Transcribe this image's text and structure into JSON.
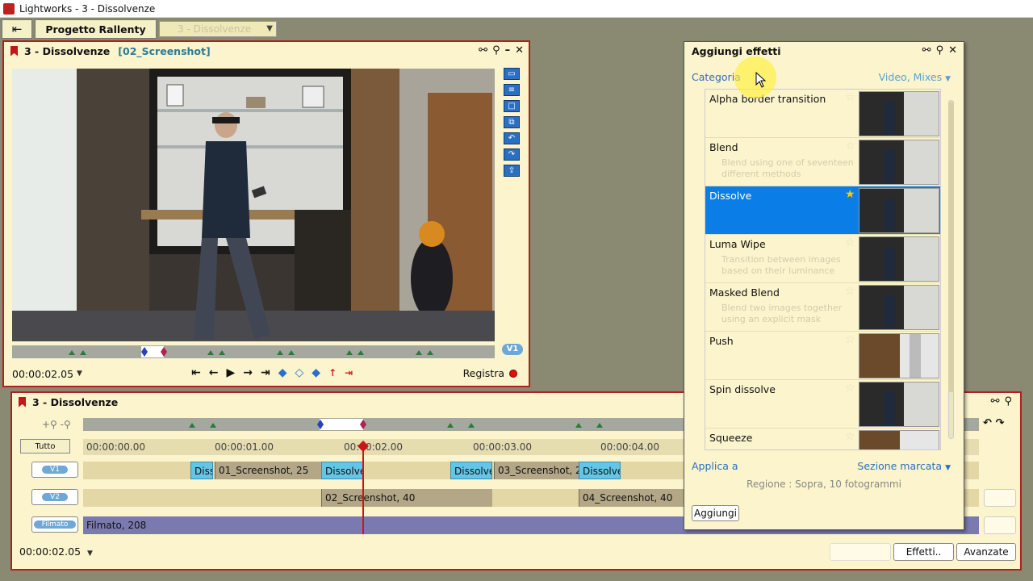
{
  "window": {
    "title": "Lightworks - 3 - Dissolvenze"
  },
  "toolbar": {
    "project_label": "Progetto Rallenty",
    "edit_select": "3 - Dissolvenze"
  },
  "viewer": {
    "title": "3 - Dissolvenze",
    "subtitle": "[02_Screenshot]",
    "track_badge": "V1",
    "timecode": "00:00:02.05",
    "record_label": "Registra"
  },
  "timeline": {
    "title": "3 - Dissolvenze",
    "all_button": "Tutto",
    "ticks": [
      "00:00:00.00",
      "00:00:01.00",
      "00:00:02.00",
      "00:00:03.00",
      "00:00:04.00"
    ],
    "tracks": [
      {
        "label": "V1",
        "clips": [
          "Diss",
          "01_Screenshot, 25",
          "Dissolve",
          "Dissolve",
          "03_Screenshot, 2",
          "Dissolve"
        ]
      },
      {
        "label": "V2",
        "clips": [
          "02_Screenshot, 40",
          "04_Screenshot, 40"
        ]
      },
      {
        "label": "Filmato",
        "clips": [
          "Filmato, 208"
        ]
      }
    ],
    "timecode": "00:00:02.05",
    "effects_button": "Effetti..",
    "advanced_button": "Avanzate"
  },
  "effects": {
    "title": "Aggiungi effetti",
    "category_label": "Categoria",
    "category_value": "Video, Mixes",
    "items": [
      {
        "name": "Alpha border transition",
        "desc": "",
        "selected": false
      },
      {
        "name": "Blend",
        "desc": "Blend using one of seventeen different methods",
        "selected": false
      },
      {
        "name": "Dissolve",
        "desc": "",
        "selected": true
      },
      {
        "name": "Luma Wipe",
        "desc": "Transition between images based on their luminance",
        "selected": false
      },
      {
        "name": "Masked Blend",
        "desc": "Blend two images together using an explicit mask",
        "selected": false
      },
      {
        "name": "Push",
        "desc": "",
        "selected": false
      },
      {
        "name": "Spin dissolve",
        "desc": "",
        "selected": false
      },
      {
        "name": "Squeeze",
        "desc": "",
        "selected": false
      }
    ],
    "apply_label": "Applica a",
    "apply_value": "Sezione marcata",
    "region_text": "Regione : Sopra, 10 fotogrammi",
    "add_button": "Aggiungi"
  },
  "colors": {
    "panel_bg": "#fbf4cc",
    "panel_border": "#b02020",
    "accent_blue": "#0a7ee6",
    "clip_cyan": "#63c5e8",
    "clip_tan": "#b3a787",
    "clip_purple": "#7a7ab0"
  }
}
